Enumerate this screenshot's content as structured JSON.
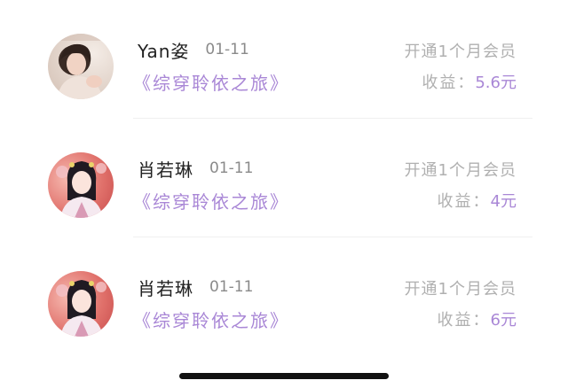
{
  "records": [
    {
      "avatar": "photo-avatar-girl",
      "name": "Yan姿",
      "date": "01-11",
      "book": "《综穿聆依之旅》",
      "member": "开通1个月会员",
      "income_label": "收益：",
      "income_value": "5.6元"
    },
    {
      "avatar": "costume-avatar-girl",
      "name": "肖若琳",
      "date": "01-11",
      "book": "《综穿聆依之旅》",
      "member": "开通1个月会员",
      "income_label": "收益：",
      "income_value": "4元"
    },
    {
      "avatar": "costume-avatar-girl",
      "name": "肖若琳",
      "date": "01-11",
      "book": "《综穿聆依之旅》",
      "member": "开通1个月会员",
      "income_label": "收益：",
      "income_value": "6元"
    }
  ],
  "colors": {
    "accent_purple": "#a987d6",
    "muted_gray": "#b0b0b0",
    "name_dark": "#222222"
  }
}
